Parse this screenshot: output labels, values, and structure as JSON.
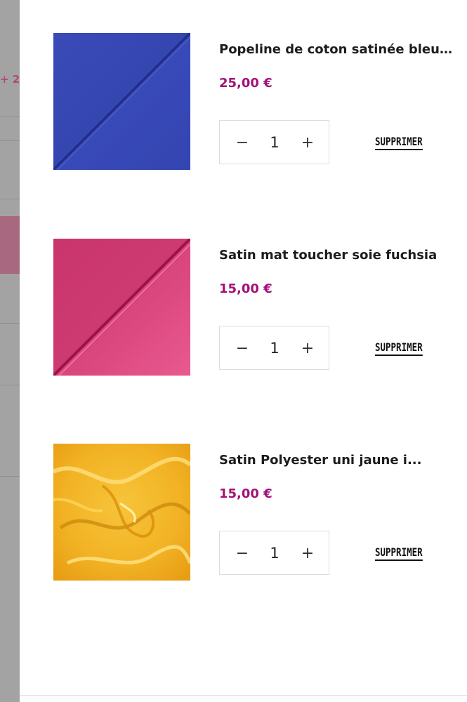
{
  "backdrop": {
    "partial_text": "+ 2"
  },
  "cart": {
    "items": [
      {
        "title": "Popeline de coton satinée bleu roi",
        "price": "25,00 €",
        "quantity": "1",
        "remove_label": "SUPPRIMER",
        "swatch": "royal-blue-fabric"
      },
      {
        "title": "Satin mat toucher soie fuchsia",
        "price": "15,00 €",
        "quantity": "1",
        "remove_label": "SUPPRIMER",
        "swatch": "fuchsia-satin-fabric"
      },
      {
        "title": "Satin Polyester uni jaune i...",
        "price": "15,00 €",
        "quantity": "1",
        "remove_label": "SUPPRIMER",
        "swatch": "yellow-satin-fabric"
      }
    ],
    "decrement_symbol": "−",
    "increment_symbol": "+"
  },
  "colors": {
    "price": "#a3117a",
    "overlay": "#9c9c9c"
  }
}
